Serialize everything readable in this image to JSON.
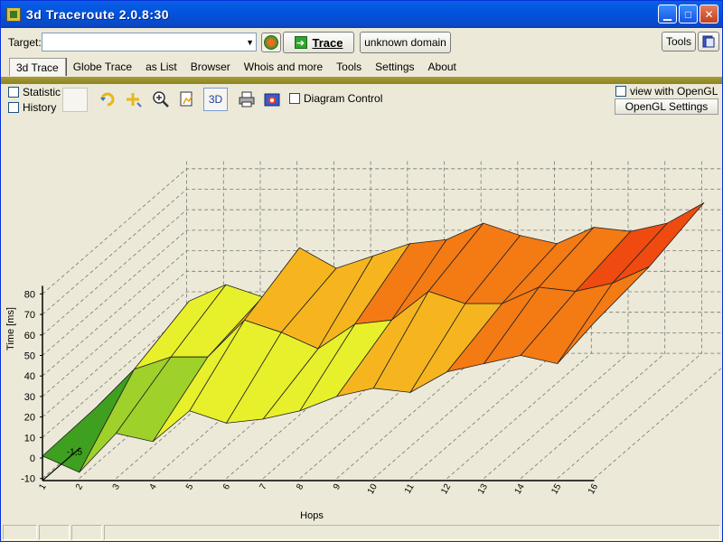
{
  "window": {
    "title": "3d Traceroute 2.0.8:30"
  },
  "targetbar": {
    "label": "Target:",
    "value": "",
    "trace_label": "Trace",
    "domain_label": "unknown domain",
    "tools_label": "Tools"
  },
  "menu": [
    {
      "label": "3d Trace",
      "active": true
    },
    {
      "label": "Globe Trace"
    },
    {
      "label": "as List"
    },
    {
      "label": "Browser"
    },
    {
      "label": "Whois and more"
    },
    {
      "label": "Tools"
    },
    {
      "label": "Settings"
    },
    {
      "label": "About"
    }
  ],
  "toolbar": {
    "statistic_label": "Statistic",
    "history_label": "History",
    "btn3d_label": "3D",
    "diagram_label": "Diagram Control",
    "opengl_check_label": "view with OpenGL",
    "opengl_button_label": "OpenGL Settings"
  },
  "chart_data": {
    "type": "area",
    "ylabel": "Time [ms]",
    "xlabel": "Hops",
    "ylim": [
      -10,
      80
    ],
    "y_ticks": [
      "80",
      "70",
      "60",
      "50",
      "40",
      "30",
      "20",
      "10",
      "0",
      "-10"
    ],
    "x_ticks": [
      "1",
      "2",
      "3",
      "4",
      "5",
      "6",
      "7",
      "8",
      "9",
      "10",
      "11",
      "12",
      "13",
      "14",
      "15",
      "16"
    ],
    "depth_label": "-1,5",
    "series": [
      {
        "values": [
          1,
          -7,
          12,
          8,
          23,
          17,
          19,
          23,
          30,
          34,
          32,
          42,
          46,
          50,
          46,
          66
        ]
      },
      {
        "values": [
          2,
          20,
          26,
          26,
          44,
          38,
          30,
          42,
          44,
          58,
          52,
          52,
          60,
          58,
          62,
          70
        ]
      },
      {
        "values": [
          3,
          30,
          38,
          32,
          56,
          46,
          52,
          58,
          60,
          68,
          62,
          58,
          66,
          64,
          68,
          78
        ]
      }
    ],
    "grid": true,
    "colors": [
      "#3f9f1f",
      "#9ed12a",
      "#e7f02a",
      "#f6b51e",
      "#f47a14",
      "#ef4a10"
    ]
  }
}
